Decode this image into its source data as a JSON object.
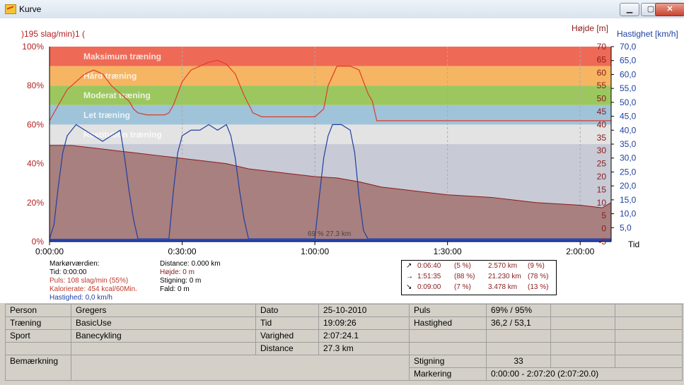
{
  "window": {
    "title": "Kurve",
    "min_btn": "▁",
    "max_btn": "▢",
    "close_btn": "✕"
  },
  "colors": {
    "red_axis": "#b22222",
    "blue_axis": "#1f3fa0",
    "max_zone": "#ef6a56",
    "hard_zone": "#f5b562",
    "moderate_zone": "#9cc75f",
    "easy_zone": "#9fc3d9",
    "recovery_zone": "#e3e3e3"
  },
  "chart_data": {
    "type": "area",
    "left_axis": {
      "title": ")195 slag/min)1 (",
      "ticks": [
        "100%",
        "80%",
        "60%",
        "40%",
        "20%",
        "0%"
      ]
    },
    "height_axis": {
      "title": "Højde [m]",
      "ticks": [
        "70",
        "65",
        "60",
        "55",
        "50",
        "45",
        "40",
        "35",
        "30",
        "25",
        "20",
        "15",
        "10",
        "5",
        "0",
        "-5"
      ]
    },
    "speed_axis": {
      "title": "Hastighet [km/h]",
      "ticks": [
        "70,0",
        "65,0",
        "60,0",
        "55,0",
        "50,0",
        "45,0",
        "40,0",
        "35,0",
        "30,0",
        "25,0",
        "20,0",
        "15,0",
        "10,0",
        "5,0"
      ]
    },
    "x_axis": {
      "title": "Tid",
      "ticks": [
        "0:00:00",
        "0:30:00",
        "1:00:00",
        "1:30:00",
        "2:00:00"
      ]
    },
    "zones": [
      {
        "name": "Maksimum træning",
        "from_pct": 90,
        "to_pct": 100
      },
      {
        "name": "Hård træning",
        "from_pct": 80,
        "to_pct": 90
      },
      {
        "name": "Moderat træning",
        "from_pct": 70,
        "to_pct": 80
      },
      {
        "name": "Let træning",
        "from_pct": 60,
        "to_pct": 70
      },
      {
        "name": "Restitution træning",
        "from_pct": 50,
        "to_pct": 60
      }
    ],
    "series": [
      {
        "name": "Puls",
        "unit": "%",
        "points": [
          [
            0,
            62
          ],
          [
            2,
            70
          ],
          [
            4,
            78
          ],
          [
            6,
            82
          ],
          [
            8,
            86
          ],
          [
            10,
            88
          ],
          [
            12,
            86
          ],
          [
            14,
            80
          ],
          [
            16,
            76
          ],
          [
            18,
            72
          ],
          [
            19,
            68
          ],
          [
            20,
            66
          ],
          [
            22,
            65
          ],
          [
            24,
            65
          ],
          [
            26,
            65
          ],
          [
            27,
            66
          ],
          [
            28,
            70
          ],
          [
            30,
            82
          ],
          [
            32,
            88
          ],
          [
            34,
            90
          ],
          [
            36,
            92
          ],
          [
            38,
            93
          ],
          [
            40,
            91
          ],
          [
            42,
            86
          ],
          [
            44,
            75
          ],
          [
            46,
            66
          ],
          [
            48,
            64
          ],
          [
            52,
            64
          ],
          [
            56,
            64
          ],
          [
            60,
            64
          ],
          [
            62,
            68
          ],
          [
            63,
            80
          ],
          [
            65,
            90
          ],
          [
            68,
            90
          ],
          [
            70,
            88
          ],
          [
            71,
            82
          ],
          [
            72,
            76
          ],
          [
            73,
            72
          ],
          [
            74,
            62
          ],
          [
            80,
            62
          ],
          [
            90,
            62
          ],
          [
            100,
            62
          ],
          [
            110,
            62
          ],
          [
            120,
            62
          ],
          [
            127,
            62
          ]
        ]
      },
      {
        "name": "Hastighed",
        "unit": "km/h",
        "points": [
          [
            0,
            1
          ],
          [
            1,
            6
          ],
          [
            2,
            20
          ],
          [
            3,
            32
          ],
          [
            4,
            38
          ],
          [
            6,
            42
          ],
          [
            8,
            40
          ],
          [
            10,
            38
          ],
          [
            12,
            36
          ],
          [
            14,
            38
          ],
          [
            16,
            40
          ],
          [
            17,
            30
          ],
          [
            18,
            18
          ],
          [
            19,
            8
          ],
          [
            20,
            1
          ],
          [
            27,
            1
          ],
          [
            28,
            18
          ],
          [
            29,
            32
          ],
          [
            30,
            38
          ],
          [
            32,
            40
          ],
          [
            34,
            40
          ],
          [
            36,
            42
          ],
          [
            38,
            40
          ],
          [
            40,
            42
          ],
          [
            41,
            38
          ],
          [
            42,
            30
          ],
          [
            43,
            18
          ],
          [
            44,
            8
          ],
          [
            45,
            1
          ],
          [
            60,
            1
          ],
          [
            61,
            16
          ],
          [
            62,
            30
          ],
          [
            63,
            38
          ],
          [
            64,
            42
          ],
          [
            66,
            42
          ],
          [
            68,
            40
          ],
          [
            69,
            32
          ],
          [
            70,
            16
          ],
          [
            71,
            4
          ],
          [
            72,
            1
          ],
          [
            127,
            1
          ]
        ]
      },
      {
        "name": "Højde",
        "unit": "m",
        "points": [
          [
            0,
            32
          ],
          [
            5,
            32
          ],
          [
            10,
            31
          ],
          [
            15,
            30
          ],
          [
            20,
            29
          ],
          [
            25,
            28
          ],
          [
            30,
            27
          ],
          [
            35,
            26
          ],
          [
            40,
            25
          ],
          [
            45,
            23
          ],
          [
            50,
            22
          ],
          [
            55,
            21
          ],
          [
            60,
            20
          ],
          [
            65,
            19.5
          ],
          [
            70,
            18
          ],
          [
            75,
            16
          ],
          [
            80,
            15
          ],
          [
            85,
            14
          ],
          [
            90,
            13
          ],
          [
            95,
            12.5
          ],
          [
            100,
            12
          ],
          [
            105,
            11
          ],
          [
            110,
            10
          ],
          [
            115,
            9.5
          ],
          [
            120,
            9
          ],
          [
            125,
            8
          ],
          [
            127,
            10
          ]
        ]
      }
    ],
    "annotation": "69 % 27.3 km"
  },
  "marker_info": {
    "col1": [
      "Markørværdien:",
      "Tid: 0:00:00",
      "Puls: 108 slag/min (55%)",
      "Kalorierate: 454 kcal/60Min.",
      "Hastighed: 0,0 km/h"
    ],
    "col2": [
      "Distance: 0.000 km",
      "Højde: 0 m",
      "Stigning: 0 m",
      "Fald: 0 m"
    ]
  },
  "stats_box": [
    {
      "arrow": "↗",
      "time": "0:06:40",
      "pct": "(5 %)",
      "dist": "2.570 km",
      "dpct": "(9 %)"
    },
    {
      "arrow": "→",
      "time": "1:51:35",
      "pct": "(88 %)",
      "dist": "21.230 km",
      "dpct": "(78 %)"
    },
    {
      "arrow": "↘",
      "time": "0:09:00",
      "pct": "(7 %)",
      "dist": "3.478 km",
      "dpct": "(13 %)"
    }
  ],
  "info_table": {
    "person_label": "Person",
    "person_value": "Gregers",
    "training_label": "Træning",
    "training_value": "BasicUse",
    "sport_label": "Sport",
    "sport_value": "Banecykling",
    "note_label": "Bemærkning",
    "date_label": "Dato",
    "date_value": "25-10-2010",
    "time_label": "Tid",
    "time_value": "19:09:26",
    "duration_label": "Varighed",
    "duration_value": "2:07:24.1",
    "distance_label": "Distance",
    "distance_value": "27.3 km",
    "pulse_label": "Puls",
    "pulse_value": "69% / 95%",
    "speed_label": "Hastighed",
    "speed_value": "36,2 / 53,1",
    "climb_label": "Stigning",
    "climb_value": "33",
    "marking_label": "Markering",
    "marking_value": "0:00:00 - 2:07:20 (2:07:20.0)"
  }
}
